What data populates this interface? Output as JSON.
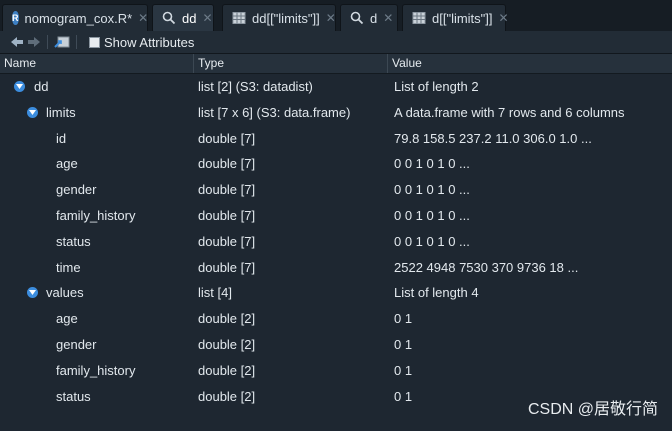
{
  "tabs": [
    {
      "label": "nomogram_cox.R*",
      "icon": "r-file-icon",
      "active": false
    },
    {
      "label": "dd",
      "icon": "magnifier-icon",
      "active": true
    },
    {
      "label": "dd[[\"limits\"]]",
      "icon": "table-icon",
      "active": false
    },
    {
      "label": "d",
      "icon": "magnifier-icon",
      "active": false
    },
    {
      "label": "d[[\"limits\"]]",
      "icon": "table-icon",
      "active": false
    }
  ],
  "toolbar": {
    "show_attributes_label": "Show Attributes"
  },
  "columns": {
    "name": "Name",
    "type": "Type",
    "value": "Value"
  },
  "rows": [
    {
      "name": "dd",
      "type": "list [2] (S3: datadist)",
      "value": "List of length 2"
    },
    {
      "name": "limits",
      "type": "list [7 x 6] (S3: data.frame)",
      "value": "A data.frame with 7 rows and 6 columns"
    },
    {
      "name": "id",
      "type": "double [7]",
      "value": "79.8 158.5 237.2 11.0 306.0 1.0 ..."
    },
    {
      "name": "age",
      "type": "double [7]",
      "value": "0 0 1 0 1 0 ..."
    },
    {
      "name": "gender",
      "type": "double [7]",
      "value": "0 0 1 0 1 0 ..."
    },
    {
      "name": "family_history",
      "type": "double [7]",
      "value": "0 0 1 0 1 0 ..."
    },
    {
      "name": "status",
      "type": "double [7]",
      "value": "0 0 1 0 1 0 ..."
    },
    {
      "name": "time",
      "type": "double [7]",
      "value": "2522 4948 7530 370 9736 18 ..."
    },
    {
      "name": "values",
      "type": "list [4]",
      "value": "List of length 4"
    },
    {
      "name": "age",
      "type": "double [2]",
      "value": "0 1"
    },
    {
      "name": "gender",
      "type": "double [2]",
      "value": "0 1"
    },
    {
      "name": "family_history",
      "type": "double [2]",
      "value": "0 1"
    },
    {
      "name": "status",
      "type": "double [2]",
      "value": "0 1"
    }
  ],
  "watermark": "CSDN @居敬行简",
  "colors": {
    "background": "#1e2731",
    "accent": "#3c8dde"
  }
}
